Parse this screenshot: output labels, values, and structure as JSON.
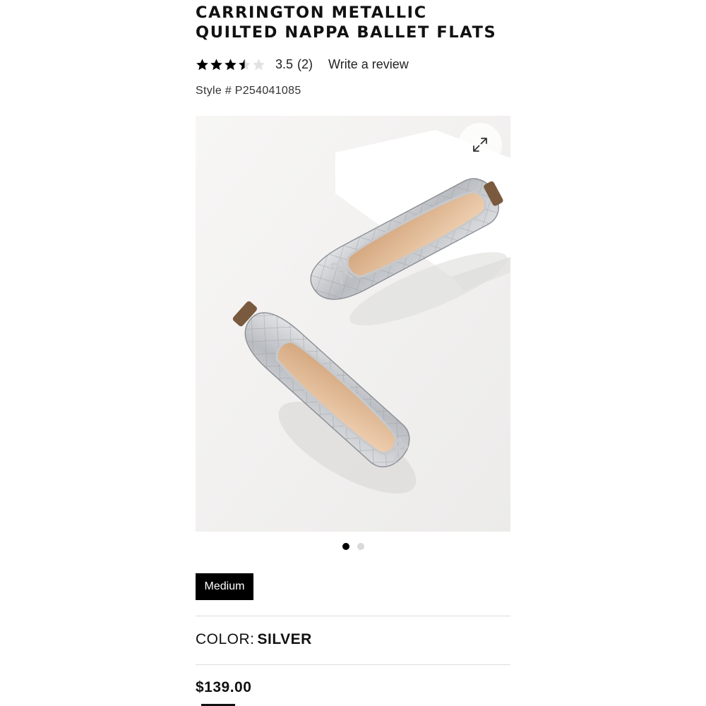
{
  "product": {
    "title_line1": "CARRINGTON METALLIC",
    "title_line2": "QUILTED NAPPA BALLET FLATS",
    "rating_value": "3.5",
    "rating_count": "(2)",
    "rating_stars": 3.5,
    "rating_max": 5,
    "write_review_label": "Write a review",
    "style_label": "Style #",
    "style_number": "P254041085",
    "width_option": "Medium",
    "color_label": "COLOR:",
    "color_value": "SILVER",
    "price": "$139.00"
  },
  "gallery": {
    "image_alt": "Silver quilted ballet flats with bow",
    "zoom_icon": "expand-icon",
    "total_images": 2,
    "active_index": 0
  },
  "colors": {
    "text": "#111111",
    "chip_bg": "#000000",
    "dot_active": "#000000",
    "dot_inactive": "#d9d9d9",
    "divider": "#dddddd"
  }
}
